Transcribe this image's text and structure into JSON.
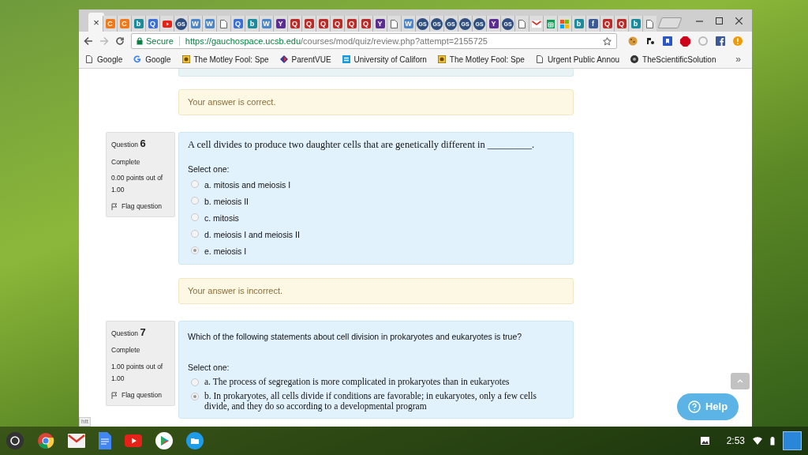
{
  "tabs": [
    {
      "kind": "active",
      "selected": true,
      "glyph": "×"
    },
    {
      "kind": "letter",
      "selected": false,
      "glyph": "C",
      "color": "#f07a1a"
    },
    {
      "kind": "letter",
      "selected": false,
      "glyph": "C",
      "color": "#f07a1a"
    },
    {
      "kind": "letter",
      "selected": false,
      "glyph": "b",
      "color": "#1b8a9a"
    },
    {
      "kind": "letter",
      "selected": false,
      "glyph": "Q",
      "color": "#3b6fd6"
    },
    {
      "kind": "video",
      "selected": false
    },
    {
      "kind": "letter",
      "selected": false,
      "glyph": "GS",
      "color": "#2f4e7f"
    },
    {
      "kind": "letter",
      "selected": false,
      "glyph": "W",
      "color": "#4a86c8"
    },
    {
      "kind": "letter",
      "selected": false,
      "glyph": "W",
      "color": "#4a86c8"
    },
    {
      "kind": "doc",
      "selected": false
    },
    {
      "kind": "letter",
      "selected": false,
      "glyph": "Q",
      "color": "#3b6fd6"
    },
    {
      "kind": "letter",
      "selected": false,
      "glyph": "b",
      "color": "#1b8a9a"
    },
    {
      "kind": "letter",
      "selected": false,
      "glyph": "W",
      "color": "#4a86c8"
    },
    {
      "kind": "letter",
      "selected": false,
      "glyph": "Y",
      "color": "#5c2d91"
    },
    {
      "kind": "letter",
      "selected": false,
      "glyph": "Q",
      "color": "#b92b27"
    },
    {
      "kind": "letter",
      "selected": false,
      "glyph": "Q",
      "color": "#b92b27"
    },
    {
      "kind": "letter",
      "selected": false,
      "glyph": "Q",
      "color": "#b92b27"
    },
    {
      "kind": "letter",
      "selected": false,
      "glyph": "Q",
      "color": "#b92b27"
    },
    {
      "kind": "letter",
      "selected": false,
      "glyph": "Q",
      "color": "#b92b27"
    },
    {
      "kind": "letter",
      "selected": false,
      "glyph": "Q",
      "color": "#b92b27"
    },
    {
      "kind": "letter",
      "selected": false,
      "glyph": "Y",
      "color": "#5c2d91"
    },
    {
      "kind": "doc",
      "selected": false
    },
    {
      "kind": "letter",
      "selected": false,
      "glyph": "W",
      "color": "#4a86c8"
    },
    {
      "kind": "letter",
      "selected": false,
      "glyph": "GS",
      "color": "#2f4e7f"
    },
    {
      "kind": "letter",
      "selected": false,
      "glyph": "GS",
      "color": "#2f4e7f"
    },
    {
      "kind": "letter",
      "selected": false,
      "glyph": "GS",
      "color": "#2f4e7f"
    },
    {
      "kind": "letter",
      "selected": false,
      "glyph": "GS",
      "color": "#2f4e7f"
    },
    {
      "kind": "letter",
      "selected": false,
      "glyph": "GS",
      "color": "#2f4e7f"
    },
    {
      "kind": "letter",
      "selected": false,
      "glyph": "Y",
      "color": "#5c2d91"
    },
    {
      "kind": "letter",
      "selected": false,
      "glyph": "GS",
      "color": "#2f4e7f"
    },
    {
      "kind": "doc",
      "selected": false
    },
    {
      "kind": "mail",
      "selected": false
    },
    {
      "kind": "sheet",
      "selected": false
    },
    {
      "kind": "squares",
      "selected": false
    },
    {
      "kind": "letter",
      "selected": false,
      "glyph": "b",
      "color": "#1b8a9a"
    },
    {
      "kind": "letter",
      "selected": false,
      "glyph": "f",
      "color": "#3b5998"
    },
    {
      "kind": "letter",
      "selected": false,
      "glyph": "Q",
      "color": "#b92b27"
    },
    {
      "kind": "letter",
      "selected": false,
      "glyph": "Q",
      "color": "#b92b27"
    },
    {
      "kind": "letter",
      "selected": false,
      "glyph": "b",
      "color": "#1b8a9a"
    },
    {
      "kind": "doc",
      "selected": false
    }
  ],
  "address_bar": {
    "secure_label": "Secure",
    "url_host": "https://gauchospace.ucsb.edu",
    "url_path": "/courses/mod/quiz/review.php?attempt=2155725"
  },
  "bookmarks": [
    {
      "label": "Google",
      "kind": "page"
    },
    {
      "label": "Google",
      "kind": "google"
    },
    {
      "label": "The Motley Fool: Spe",
      "kind": "fool"
    },
    {
      "label": "ParentVUE",
      "kind": "diamond"
    },
    {
      "label": "University of Californ",
      "kind": "uc"
    },
    {
      "label": "The Motley Fool: Spe",
      "kind": "fool"
    },
    {
      "label": "Urgent Public Annou",
      "kind": "page"
    },
    {
      "label": "TheScientificSolution",
      "kind": "dot"
    }
  ],
  "bookmarks_overflow": "»",
  "feedback_top": "Your answer is correct.",
  "questions": [
    {
      "label": "Question",
      "number": "6",
      "state": "Complete",
      "grade": "0.00 points out of 1.00",
      "flag": "Flag question",
      "prompt": "A cell divides to produce two daughter cells that are genetically different in _________.",
      "prompt_serif": true,
      "select_label": "Select one:",
      "options_serif": false,
      "options": [
        {
          "label": "a. mitosis and meiosis I",
          "selected": false
        },
        {
          "label": "b. meiosis II",
          "selected": false
        },
        {
          "label": "c. mitosis",
          "selected": false
        },
        {
          "label": "d. meiosis I and meiosis II",
          "selected": false
        },
        {
          "label": "e. meiosis I",
          "selected": true
        }
      ],
      "feedback": "Your answer is incorrect."
    },
    {
      "label": "Question",
      "number": "7",
      "state": "Complete",
      "grade": "1.00 points out of 1.00",
      "flag": "Flag question",
      "prompt": "Which of the following statements about cell division in prokaryotes and eukaryotes is true?",
      "prompt_serif": false,
      "select_label": "Select one:",
      "options_serif": true,
      "options": [
        {
          "label": "a. The process of segregation is more complicated in prokaryotes than in eukaryotes",
          "selected": false
        },
        {
          "label": "b. In prokaryotes, all cells divide if conditions are favorable; in eukaryotes, only a few cells divide, and they do so according to a developmental program",
          "selected": true
        }
      ]
    }
  ],
  "help_button": "Help",
  "status_link": "htt",
  "clock": "2:53"
}
